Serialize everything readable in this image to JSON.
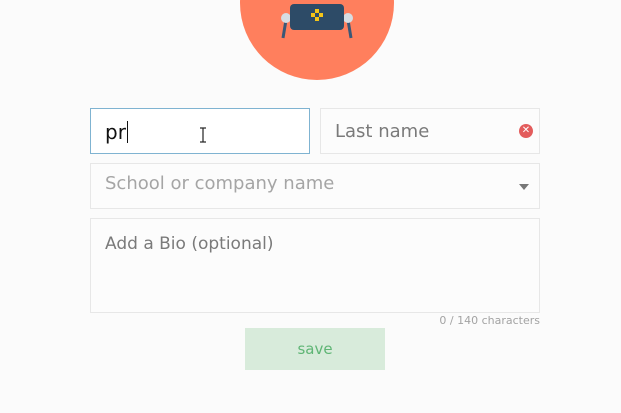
{
  "profile_form": {
    "first_name": {
      "value": "pr",
      "focused": true
    },
    "last_name": {
      "placeholder": "Last name",
      "clear_icon": "close-circle-icon"
    },
    "school": {
      "placeholder": "School or company name",
      "dropdown_icon": "chevron-down-icon"
    },
    "bio": {
      "placeholder": "Add a Bio (optional)"
    },
    "character_counter": "0 / 140 characters",
    "save_label": "save"
  },
  "avatar": {
    "icon": "robot-icon",
    "background_color": "#ff7f5d"
  },
  "colors": {
    "focus_border": "#7fb3d1",
    "save_background": "#d8ebdb",
    "save_text": "#5fb575",
    "clear_icon": "#e35c5c"
  }
}
